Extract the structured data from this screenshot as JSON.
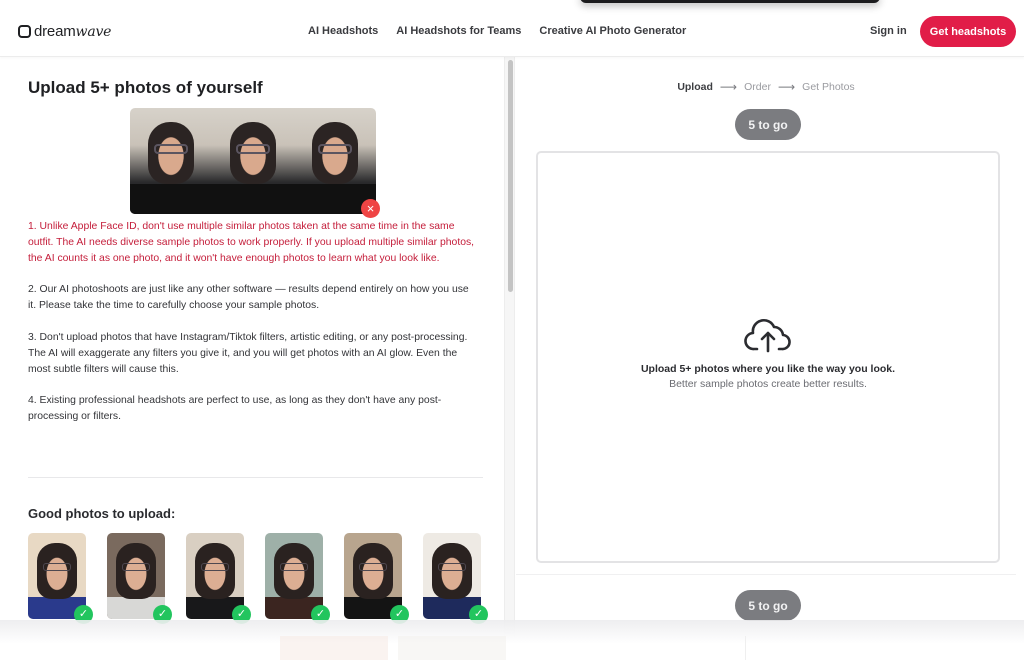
{
  "header": {
    "logo_main": "dream",
    "logo_italic": "wave",
    "nav": [
      {
        "label": "AI Headshots"
      },
      {
        "label": "AI Headshots for Teams"
      },
      {
        "label": "Creative AI Photo Generator"
      }
    ],
    "sign_in": "Sign in",
    "cta": "Get headshots"
  },
  "colors": {
    "brand_red": "#e11d48",
    "warning_text": "#c41d3a",
    "success_green": "#22c55e",
    "remove_red": "#ef4444",
    "pill_gray": "#7b7c80"
  },
  "left": {
    "title": "Upload 5+ photos of yourself",
    "bad_example": {
      "photo_count": 3,
      "badge_icon": "close-icon",
      "badge_glyph": "×"
    },
    "tips": [
      {
        "text": "1. Unlike Apple Face ID, don't use multiple similar photos taken at the same time in the same outfit. The AI needs diverse sample photos to work properly. If you upload multiple similar photos, the AI counts it as one photo, and it won't have enough photos to learn what you look like.",
        "warning": true
      },
      {
        "text": "2. Our AI photoshoots are just like any other software — results depend entirely on how you use it. Please take the time to carefully choose your sample photos.",
        "warning": false
      },
      {
        "text": "3. Don't upload photos that have Instagram/Tiktok filters, artistic editing, or any post-processing. The AI will exaggerate any filters you give it, and you will get photos with an AI glow. Even the most subtle filters will cause this.",
        "warning": false
      },
      {
        "text": "4. Existing professional headshots are perfect to use, as long as they don't have any post-processing or filters.",
        "warning": false
      }
    ],
    "good_title": "Good photos to upload:",
    "good_photos": [
      {
        "bg": "#e8d9c4",
        "torso": "#2a3a8c"
      },
      {
        "bg": "#7a6a5e",
        "torso": "#d8d8d6"
      },
      {
        "bg": "#d9cfc2",
        "torso": "#18181a"
      },
      {
        "bg": "#9eb0a8",
        "torso": "#3b2520"
      },
      {
        "bg": "#b8a58e",
        "torso": "#141414"
      },
      {
        "bg": "#eeeae4",
        "torso": "#1e2a5c"
      }
    ],
    "check_glyph": "✓"
  },
  "right": {
    "steps": [
      {
        "label": "Upload",
        "active": true
      },
      {
        "label": "Order",
        "active": false
      },
      {
        "label": "Get Photos",
        "active": false
      }
    ],
    "arrow_glyph": "⟶",
    "remaining_top": "5 to go",
    "remaining_bottom": "5 to go",
    "dropzone_title": "Upload 5+ photos where you like the way you look.",
    "dropzone_subtitle": "Better sample photos create better results."
  }
}
